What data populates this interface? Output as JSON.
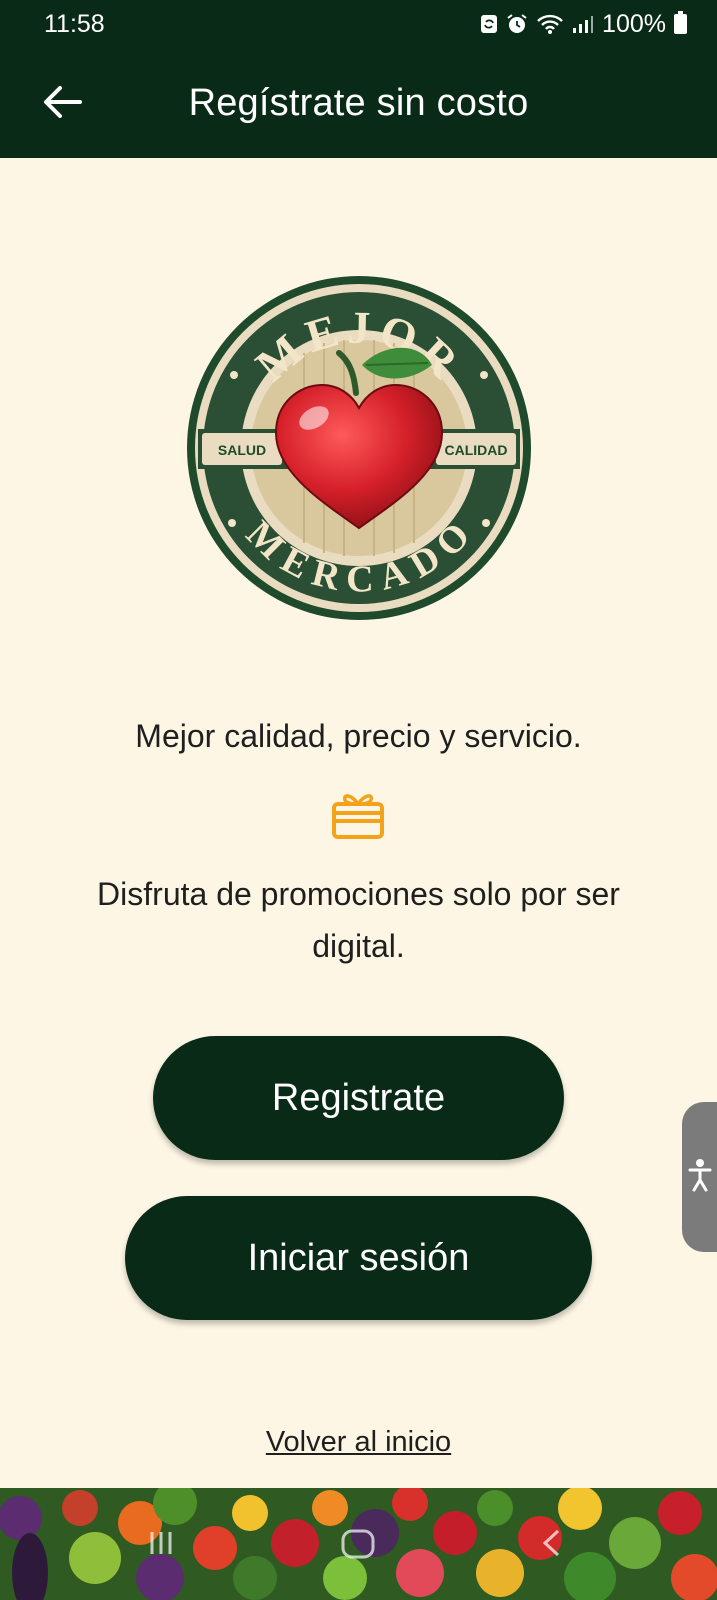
{
  "status_bar": {
    "time": "11:58",
    "battery": "100%",
    "icons": [
      "sync-icon",
      "alarm-icon",
      "wifi-icon",
      "signal-icon",
      "battery-icon"
    ]
  },
  "app_bar": {
    "title": "Regístrate sin costo",
    "back_icon": "arrow-left-icon"
  },
  "logo": {
    "top_text": "MEJOR",
    "bottom_text": "MERCADO",
    "left_label": "SALUD",
    "right_label": "CALIDAD"
  },
  "tagline": "Mejor calidad, precio y servicio.",
  "promo_icon": "gift-card-icon",
  "promo_text": "Disfruta de promociones solo por ser digital.",
  "buttons": {
    "register": "Registrate",
    "login": "Iniciar sesión"
  },
  "back_home_link": "Volver al inicio",
  "accessibility_icon": "accessibility-icon",
  "colors": {
    "primary": "#0a2a18",
    "background": "#fdf6e4",
    "accent": "#f5a21b",
    "logo_red": "#d5202a",
    "logo_green": "#1f4a2c"
  }
}
